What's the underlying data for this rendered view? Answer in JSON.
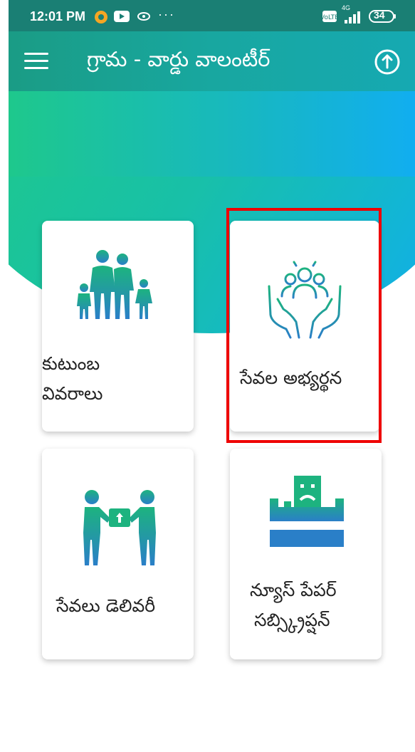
{
  "status_bar": {
    "time": "12:01 PM",
    "battery": "34",
    "network": "4G"
  },
  "app_bar": {
    "title": "గ్రామ - వార్డు వాలంటీర్"
  },
  "cards": [
    {
      "label_line1": "కుటుంబ",
      "label_line2": "వివరాలు",
      "icon": "family-icon"
    },
    {
      "label_line1": "సేవల అభ్యర్థన",
      "label_line2": "",
      "icon": "service-request-icon"
    },
    {
      "label_line1": "సేవలు డెలివరీ",
      "label_line2": "",
      "icon": "service-delivery-icon"
    },
    {
      "label_line1": "న్యూస్ పేపర్",
      "label_line2": "సబ్స్క్రిప్షన్",
      "icon": "newspaper-subscription-icon"
    }
  ],
  "colors": {
    "status_bar": "#1a7f74",
    "app_bar": "#18a7a0",
    "icon_teal": "#18a68c",
    "icon_blue": "#2a7fc8",
    "highlight": "#ee0000"
  }
}
